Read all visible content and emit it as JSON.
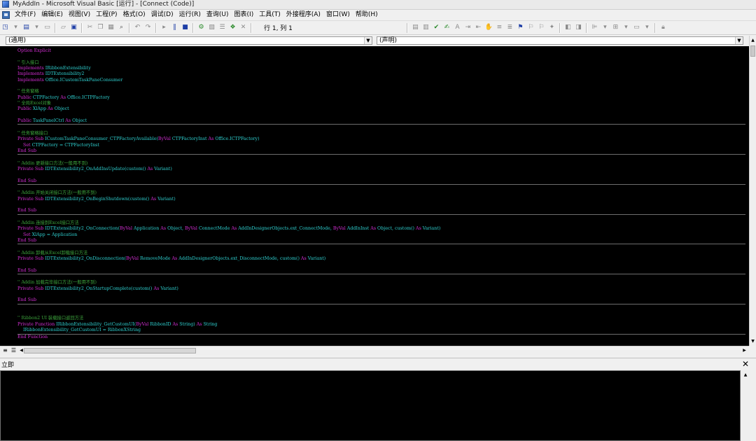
{
  "window": {
    "title": "MyAddIn - Microsoft Visual Basic [运行] - [Connect (Code)]"
  },
  "menu": [
    "文件(F)",
    "编辑(E)",
    "视图(V)",
    "工程(P)",
    "格式(O)",
    "调试(D)",
    "运行(R)",
    "查询(U)",
    "图表(I)",
    "工具(T)",
    "外接程序(A)",
    "窗口(W)",
    "帮助(H)"
  ],
  "toolbar": {
    "cursor_position": "行 1, 列 1"
  },
  "dropdowns": {
    "object": "(通用)",
    "procedure": "(声明)"
  },
  "code": [
    [
      {
        "t": "Option Explicit",
        "c": "kw"
      }
    ],
    [],
    [
      {
        "t": "'' 引入接口",
        "c": "cm"
      }
    ],
    [
      {
        "t": "Implements ",
        "c": "kw"
      },
      {
        "t": "IRibbonExtensibility",
        "c": "id"
      }
    ],
    [
      {
        "t": "Implements ",
        "c": "kw"
      },
      {
        "t": "IDTExtensibility2",
        "c": "id"
      }
    ],
    [
      {
        "t": "Implements ",
        "c": "kw"
      },
      {
        "t": "Office.ICustomTaskPaneConsumer",
        "c": "id"
      }
    ],
    [],
    [
      {
        "t": "'' 任务窗格",
        "c": "cm"
      }
    ],
    [
      {
        "t": "Public ",
        "c": "kw"
      },
      {
        "t": "CTPFactory ",
        "c": "id"
      },
      {
        "t": "As ",
        "c": "kw"
      },
      {
        "t": "Office.ICTPFactory",
        "c": "id"
      }
    ],
    [
      {
        "t": "'' 全局Excel对象",
        "c": "cm"
      }
    ],
    [
      {
        "t": "Public ",
        "c": "kw"
      },
      {
        "t": "XlApp ",
        "c": "id"
      },
      {
        "t": "As ",
        "c": "kw"
      },
      {
        "t": "Object",
        "c": "id"
      }
    ],
    [],
    [
      {
        "t": "Public ",
        "c": "kw"
      },
      {
        "t": "TaskPanelCtrl ",
        "c": "id"
      },
      {
        "t": "As ",
        "c": "kw"
      },
      {
        "t": "Object",
        "c": "id"
      }
    ],
    [],
    [
      {
        "t": "'' 任务窗格接口",
        "c": "cm"
      }
    ],
    [
      {
        "t": "Private Sub ",
        "c": "kw"
      },
      {
        "t": "ICustomTaskPaneConsumer_CTPFactoryAvailable(",
        "c": "id"
      },
      {
        "t": "ByVal ",
        "c": "kw"
      },
      {
        "t": "CTPFactoryInst ",
        "c": "id"
      },
      {
        "t": "As ",
        "c": "kw"
      },
      {
        "t": "Office.ICTPFactory)",
        "c": "id"
      }
    ],
    [
      {
        "t": "    Set ",
        "c": "kw"
      },
      {
        "t": "CTPFactory = CTPFactoryInst",
        "c": "id"
      }
    ],
    [
      {
        "t": "End Sub",
        "c": "kw"
      }
    ],
    [],
    [
      {
        "t": "'' Addin 更新接口方法(一般用不到)",
        "c": "cm"
      }
    ],
    [
      {
        "t": "Private Sub ",
        "c": "kw"
      },
      {
        "t": "IDTExtensibility2_OnAddInsUpdate(custom() ",
        "c": "id"
      },
      {
        "t": "As ",
        "c": "kw"
      },
      {
        "t": "Variant)",
        "c": "id"
      }
    ],
    [],
    [
      {
        "t": "End Sub",
        "c": "kw"
      }
    ],
    [],
    [
      {
        "t": "'' Addin 开始关闭接口方法(一般用不到)",
        "c": "cm"
      }
    ],
    [
      {
        "t": "Private Sub ",
        "c": "kw"
      },
      {
        "t": "IDTExtensibility2_OnBeginShutdown(custom() ",
        "c": "id"
      },
      {
        "t": "As ",
        "c": "kw"
      },
      {
        "t": "Variant)",
        "c": "id"
      }
    ],
    [],
    [
      {
        "t": "End Sub",
        "c": "kw"
      }
    ],
    [],
    [
      {
        "t": "'' Addin 连接到Excel接口方法",
        "c": "cm"
      }
    ],
    [
      {
        "t": "Private Sub ",
        "c": "kw"
      },
      {
        "t": "IDTExtensibility2_OnConnection(",
        "c": "id"
      },
      {
        "t": "ByVal ",
        "c": "kw"
      },
      {
        "t": "Application ",
        "c": "id"
      },
      {
        "t": "As ",
        "c": "kw"
      },
      {
        "t": "Object, ",
        "c": "id"
      },
      {
        "t": "ByVal ",
        "c": "kw"
      },
      {
        "t": "ConnectMode ",
        "c": "id"
      },
      {
        "t": "As ",
        "c": "kw"
      },
      {
        "t": "AddInDesignerObjects.ext_ConnectMode, ",
        "c": "id"
      },
      {
        "t": "ByVal ",
        "c": "kw"
      },
      {
        "t": "AddInInst ",
        "c": "id"
      },
      {
        "t": "As ",
        "c": "kw"
      },
      {
        "t": "Object, custom() ",
        "c": "id"
      },
      {
        "t": "As ",
        "c": "kw"
      },
      {
        "t": "Variant)",
        "c": "id"
      }
    ],
    [
      {
        "t": "    Set ",
        "c": "kw"
      },
      {
        "t": "XlApp = Application",
        "c": "id"
      }
    ],
    [
      {
        "t": "End Sub",
        "c": "kw"
      }
    ],
    [],
    [
      {
        "t": "'' Addin 卸载从Excel卸载接口方法",
        "c": "cm"
      }
    ],
    [
      {
        "t": "Private Sub ",
        "c": "kw"
      },
      {
        "t": "IDTExtensibility2_OnDisconnection(",
        "c": "id"
      },
      {
        "t": "ByVal ",
        "c": "kw"
      },
      {
        "t": "RemoveMode ",
        "c": "id"
      },
      {
        "t": "As ",
        "c": "kw"
      },
      {
        "t": "AddInDesignerObjects.ext_DisconnectMode, custom() ",
        "c": "id"
      },
      {
        "t": "As ",
        "c": "kw"
      },
      {
        "t": "Variant)",
        "c": "id"
      }
    ],
    [],
    [
      {
        "t": "End Sub",
        "c": "kw"
      }
    ],
    [],
    [
      {
        "t": "'' Addin 加载完毕接口方法(一般用不到)",
        "c": "cm"
      }
    ],
    [
      {
        "t": "Private Sub ",
        "c": "kw"
      },
      {
        "t": "IDTExtensibility2_OnStartupComplete(custom() ",
        "c": "id"
      },
      {
        "t": "As ",
        "c": "kw"
      },
      {
        "t": "Variant)",
        "c": "id"
      }
    ],
    [],
    [
      {
        "t": "End Sub",
        "c": "kw"
      }
    ],
    [],
    [],
    [
      {
        "t": "'' Ribbon2 UI 装载接口返回方法",
        "c": "cm"
      }
    ],
    [
      {
        "t": "Private Function ",
        "c": "kw"
      },
      {
        "t": "IRibbonExtensibility_GetCustomUI(",
        "c": "id"
      },
      {
        "t": "ByVal ",
        "c": "kw"
      },
      {
        "t": "RibbonID ",
        "c": "id"
      },
      {
        "t": "As ",
        "c": "kw"
      },
      {
        "t": "String) ",
        "c": "id"
      },
      {
        "t": "As ",
        "c": "kw"
      },
      {
        "t": "String",
        "c": "id"
      }
    ],
    [
      {
        "t": "    IRibbonExtensibility_GetCustomUI = RibbonXString",
        "c": "id"
      }
    ],
    [
      {
        "t": "End Function",
        "c": "kw"
      }
    ]
  ],
  "immediate": {
    "title": "立即"
  }
}
